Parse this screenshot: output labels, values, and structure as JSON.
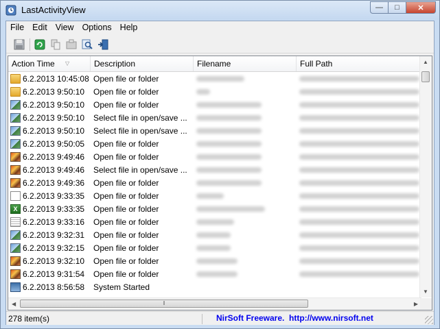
{
  "window": {
    "title": "LastActivityView"
  },
  "menu": [
    "File",
    "Edit",
    "View",
    "Options",
    "Help"
  ],
  "toolbar": [
    {
      "name": "save-icon"
    },
    {
      "name": "refresh-icon"
    },
    {
      "name": "copy-icon"
    },
    {
      "name": "properties-icon"
    },
    {
      "name": "find-icon"
    },
    {
      "name": "exit-icon"
    }
  ],
  "columns": [
    "Action Time",
    "Description",
    "Filename",
    "Full Path"
  ],
  "rows": [
    {
      "time": "6.2.2013 10:45:08",
      "desc": "Open file or folder",
      "icon": "folder"
    },
    {
      "time": "6.2.2013 9:50:10",
      "desc": "Open file or folder",
      "icon": "folder"
    },
    {
      "time": "6.2.2013 9:50:10",
      "desc": "Open file or folder",
      "icon": "image"
    },
    {
      "time": "6.2.2013 9:50:10",
      "desc": "Select file in open/save ...",
      "icon": "image"
    },
    {
      "time": "6.2.2013 9:50:10",
      "desc": "Select file in open/save ...",
      "icon": "image"
    },
    {
      "time": "6.2.2013 9:50:05",
      "desc": "Open file or folder",
      "icon": "image"
    },
    {
      "time": "6.2.2013 9:49:46",
      "desc": "Open file or folder",
      "icon": "photo"
    },
    {
      "time": "6.2.2013 9:49:46",
      "desc": "Select file in open/save ...",
      "icon": "photo"
    },
    {
      "time": "6.2.2013 9:49:36",
      "desc": "Open file or folder",
      "icon": "photo"
    },
    {
      "time": "6.2.2013 9:33:35",
      "desc": "Open file or folder",
      "icon": "doc"
    },
    {
      "time": "6.2.2013 9:33:35",
      "desc": "Open file or folder",
      "icon": "excel"
    },
    {
      "time": "6.2.2013 9:33:16",
      "desc": "Open file or folder",
      "icon": "text"
    },
    {
      "time": "6.2.2013 9:32:31",
      "desc": "Open file or folder",
      "icon": "image"
    },
    {
      "time": "6.2.2013 9:32:15",
      "desc": "Open file or folder",
      "icon": "image"
    },
    {
      "time": "6.2.2013 9:32:10",
      "desc": "Open file or folder",
      "icon": "photo"
    },
    {
      "time": "6.2.2013 9:31:54",
      "desc": "Open file or folder",
      "icon": "photo"
    },
    {
      "time": "6.2.2013 8:56:58",
      "desc": "System Started",
      "icon": "system"
    }
  ],
  "status": {
    "count": "278 item(s)",
    "link": "NirSoft Freeware.  http://www.nirsoft.net"
  }
}
